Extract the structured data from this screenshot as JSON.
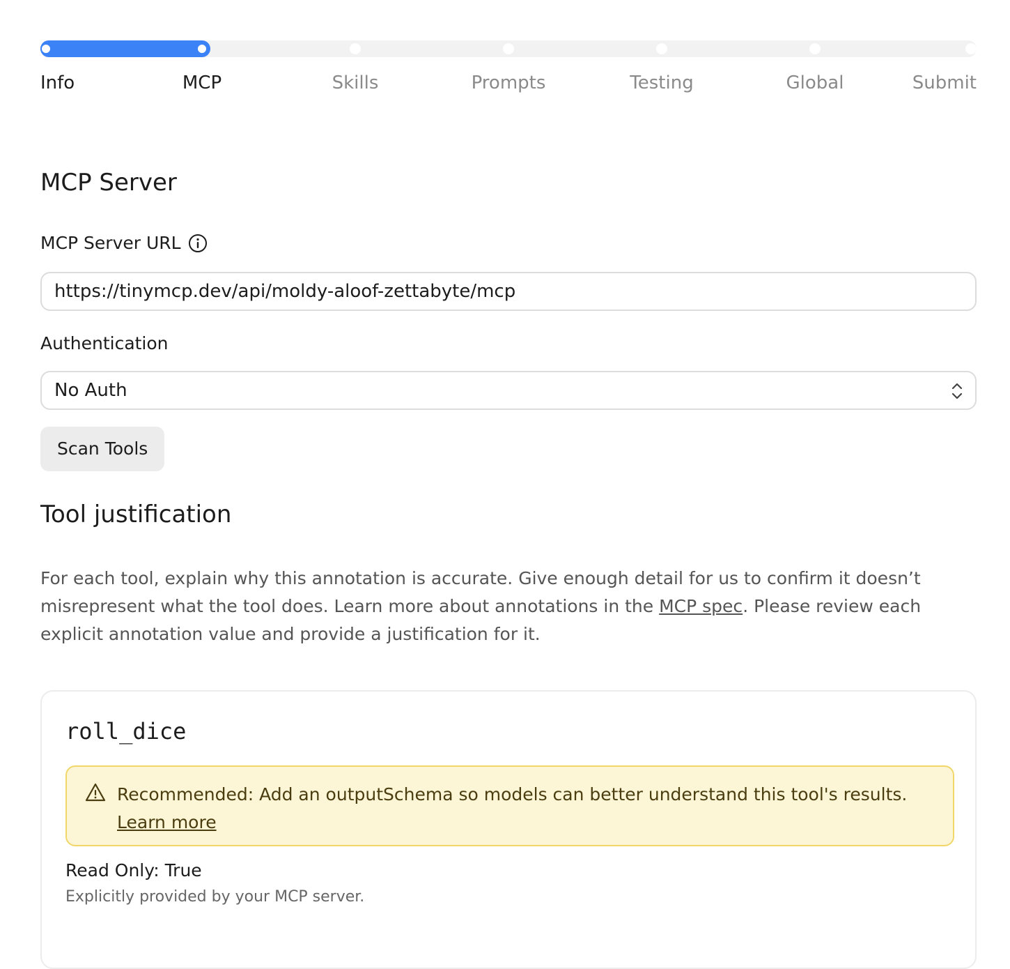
{
  "stepper": {
    "progress_fraction": 0.18,
    "steps": [
      {
        "label": "Info",
        "state": "done"
      },
      {
        "label": "MCP",
        "state": "current"
      },
      {
        "label": "Skills",
        "state": "upcoming"
      },
      {
        "label": "Prompts",
        "state": "upcoming"
      },
      {
        "label": "Testing",
        "state": "upcoming"
      },
      {
        "label": "Global",
        "state": "upcoming"
      },
      {
        "label": "Submit",
        "state": "upcoming"
      }
    ],
    "accent_color": "#3b82f6"
  },
  "mcp_server": {
    "title": "MCP Server",
    "url_label": "MCP Server URL",
    "url_value": "https://tinymcp.dev/api/moldy-aloof-zettabyte/mcp",
    "auth_label": "Authentication",
    "auth_selected": "No Auth",
    "scan_button_label": "Scan Tools"
  },
  "tool_justification": {
    "title": "Tool justification",
    "description_before_link": "For each tool, explain why this annotation is accurate. Give enough detail for us to confirm it doesn’t misrepresent what the tool does. Learn more about annotations in the ",
    "link_label": "MCP spec",
    "description_after_link": ". Please review each explicit annotation value and provide a justification for it."
  },
  "tool_card": {
    "name": "roll_dice",
    "alert_text": "Recommended: Add an outputSchema so models can better understand this tool's results.",
    "alert_link": "Learn more",
    "annotation_title": "Read Only: True",
    "annotation_note": "Explicitly provided by your MCP server."
  }
}
